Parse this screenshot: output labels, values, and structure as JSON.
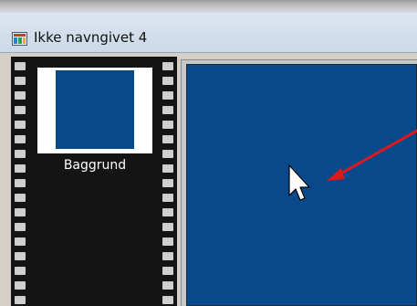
{
  "window": {
    "title": "Ikke navngivet 4",
    "icon": "app-icon"
  },
  "filmstrip": {
    "frames": [
      {
        "label": "Baggrund",
        "color": "#07498a"
      }
    ]
  },
  "canvas": {
    "background": "#07498a",
    "annotation_arrow_color": "#e0181b"
  },
  "cursor": {
    "icon": "mouse-pointer-icon"
  }
}
